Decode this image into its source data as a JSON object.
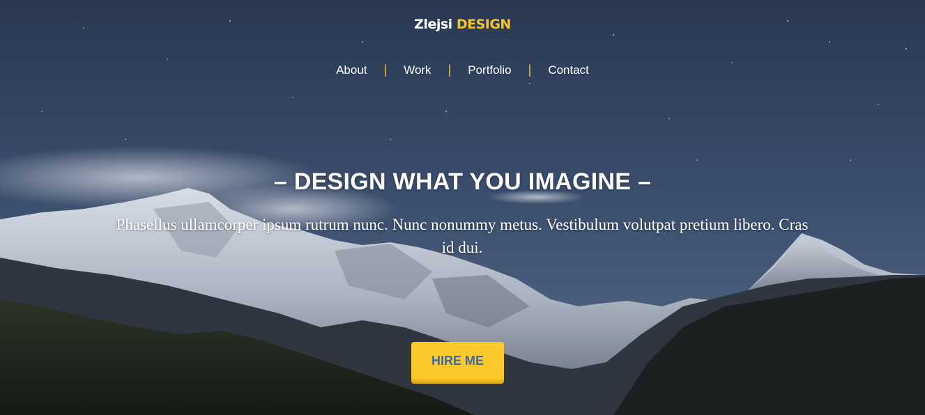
{
  "brand": {
    "name_main": "Zlejsi",
    "name_accent": "DESIGN",
    "accent_color": "#f7c52b"
  },
  "nav": {
    "items": [
      {
        "label": "About"
      },
      {
        "label": "Work"
      },
      {
        "label": "Portfolio"
      },
      {
        "label": "Contact"
      }
    ],
    "separator": "|"
  },
  "hero": {
    "headline": "– DESIGN WHAT YOU IMAGINE –",
    "subtext": "Phasellus ullamcorper ipsum rutrum nunc. Nunc nonummy metus. Vestibulum volutpat pretium libero. Cras id dui.",
    "background": "night-mountain-landscape",
    "cta": {
      "label": "HIRE ME",
      "bg_color": "#fcc92c",
      "text_color": "#3d6ba8"
    }
  }
}
